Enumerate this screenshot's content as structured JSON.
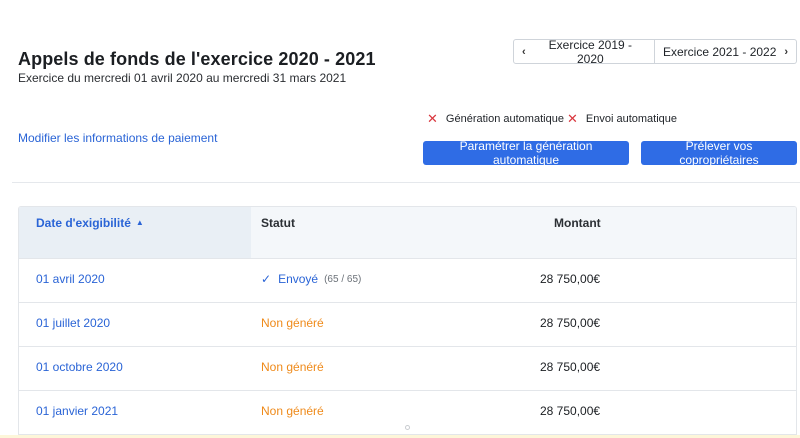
{
  "header": {
    "title": "Appels de fonds de l'exercice 2020 - 2021",
    "subtitle": "Exercice du mercredi 01 avril 2020 au mercredi 31 mars 2021"
  },
  "year_nav": {
    "prev_label": "Exercice 2019 - 2020",
    "next_label": "Exercice 2021 - 2022",
    "prev_icon": "chevron-left-icon",
    "next_icon": "chevron-right-icon"
  },
  "automation": {
    "generation_label": "Génération automatique",
    "sending_label": "Envoi automatique",
    "icon": "cross-icon",
    "icon_color": "#d9363e"
  },
  "actions": {
    "edit_payment_label": "Modifier les informations de paiement",
    "configure_label": "Paramétrer la génération automatique",
    "levy_label": "Prélever vos copropriétaires",
    "accent_color": "#2f6ce5"
  },
  "table": {
    "columns": {
      "date": "Date d'exigibilité",
      "status": "Statut",
      "amount": "Montant"
    },
    "rows": [
      {
        "date": "01 avril 2020",
        "status": "Envoyé",
        "count": "(65 / 65)",
        "amount": "28 750,00€"
      },
      {
        "date": "01 juillet 2020",
        "status": "Non généré",
        "amount": "28 750,00€"
      },
      {
        "date": "01 octobre 2020",
        "status": "Non généré",
        "amount": "28 750,00€"
      },
      {
        "date": "01 janvier 2021",
        "status": "Non généré",
        "amount": "28 750,00€"
      }
    ],
    "status_colors": {
      "sent": "#2a64d6",
      "pending": "#ef8a1a"
    }
  }
}
